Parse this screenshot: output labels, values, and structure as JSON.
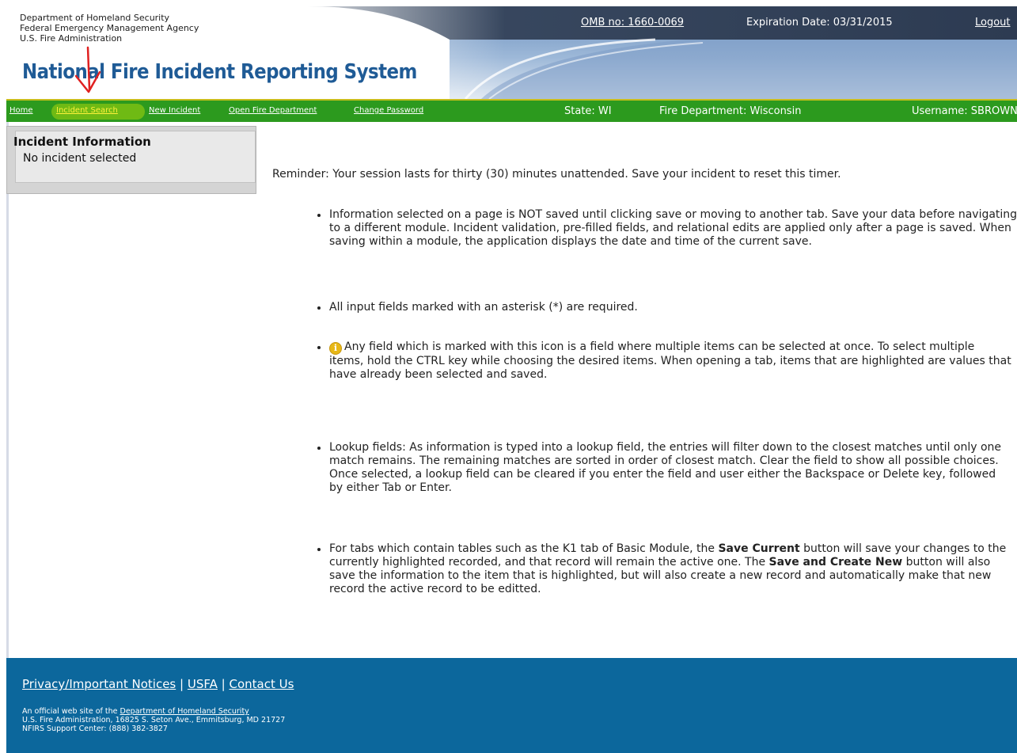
{
  "header": {
    "agency_lines": [
      "Department of Homeland Security",
      "Federal Emergency Management Agency",
      "U.S. Fire Administration"
    ],
    "site_title": "National Fire Incident Reporting System",
    "omb": "OMB no: 1660-0069",
    "expiration": "Expiration Date: 03/31/2015",
    "logout": "Logout"
  },
  "nav": {
    "links": [
      "Home",
      "Incident Search",
      "New Incident",
      "Open Fire Department",
      "Change Password"
    ],
    "state": "State: WI",
    "fire_department": "Fire Department: Wisconsin",
    "username": "Username: SBROWN"
  },
  "incident_panel": {
    "title": "Incident Information",
    "status": "No incident selected"
  },
  "main": {
    "reminder": "Reminder: Your session lasts for thirty (30) minutes unattended. Save your incident to reset this timer.",
    "bullet_1": "Information selected on a page is NOT saved until clicking save or moving to another tab. Save your data before navigating to a different module. Incident validation, pre-filled fields, and relational edits are applied only after a page is saved. When saving within a module, the application displays the date and time of the current save.",
    "bullet_2": "All input fields marked with an asterisk (*) are required.",
    "bullet_3": "Any field which is marked with this icon is a field where multiple items can be selected at once. To select multiple items, hold the CTRL key while choosing the desired items. When opening a tab, items that are highlighted are values that have already been selected and saved.",
    "bullet_4_a": "Lookup fields: As information is typed into a lookup field, the entries will filter down to the closest matches until only one match remains. The remaining matches are sorted in order of closest match. Clear the field to show all possible choices.",
    "bullet_4_b": "Once selected, a lookup field can be cleared if you enter the field and user either the Backspace or Delete key, followed by either Tab or Enter.",
    "bullet_5_a": "For tabs which contain tables such as the K1 tab of Basic Module, the ",
    "bullet_5_bold_1": "Save Current",
    "bullet_5_b": " button will save your changes to the currently highlighted recorded, and that record will remain the active one. The ",
    "bullet_5_bold_2": "Save and Create New",
    "bullet_5_c": " button will also save the information to the item that is highlighted, but will also create a new record and automatically make that new record the active record to be editted.",
    "info_icon_glyph": "i"
  },
  "footer": {
    "links": [
      "Privacy/Important Notices",
      "USFA",
      "Contact Us"
    ],
    "separator": "|",
    "line_1_prefix": "An official web site of the ",
    "line_1_link": "Department of Homeland Security",
    "line_2": "U.S. Fire Administration, 16825 S. Seton Ave., Emmitsburg, MD 21727",
    "line_3": "NFIRS Support Center: (888) 382-3827"
  },
  "colors": {
    "nav_green": "#2c9a1e",
    "nav_active_link": "#fff23a",
    "title_blue": "#1f5b96",
    "footer_blue": "#0c679c",
    "annotation_red": "#e02020"
  }
}
